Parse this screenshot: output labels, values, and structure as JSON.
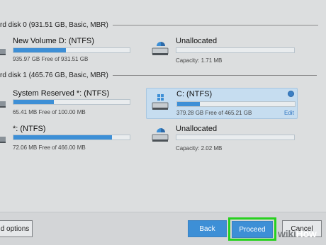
{
  "disks": [
    {
      "header": "rd disk 0 (931.51 GB, Basic, MBR)",
      "volumes": [
        {
          "name": "New Volume D: (NTFS)",
          "info": "935.97 GB Free of 931.51 GB",
          "fill": 0.42,
          "icon": "drive-icon"
        },
        {
          "name": "Unallocated",
          "info": "Capacity: 1.71 MB",
          "fill": 0,
          "icon": "drive-icon"
        }
      ]
    },
    {
      "header": "rd disk 1 (465.76 GB, Basic, MBR)",
      "volumes": [
        {
          "name": "System Reserved *: (NTFS)",
          "info": "65.41 MB Free of 100.00 MB",
          "fill": 0.34,
          "icon": "drive-icon"
        },
        {
          "name": "C: (NTFS)",
          "info": "379.28 GB Free of 465.21 GB",
          "fill": 0.19,
          "selected": true,
          "edit_label": "Edit",
          "icon": "windows-drive-icon"
        },
        {
          "name": "*: (NTFS)",
          "info": "72.06 MB Free of 466.00 MB",
          "fill": 0.85,
          "icon": "drive-icon"
        },
        {
          "name": "Unallocated",
          "info": "Capacity: 2.02 MB",
          "fill": 0,
          "icon": "drive-icon"
        }
      ]
    }
  ],
  "buttons": {
    "options": "d options",
    "back": "Back",
    "proceed": "Proceed",
    "cancel": "Cancel"
  },
  "watermark": {
    "wiki": "wiki",
    "how": "How"
  },
  "colors": {
    "accent": "#3d8fd6",
    "highlight": "#27d11f",
    "selected_bg": "#c6ddf0"
  }
}
